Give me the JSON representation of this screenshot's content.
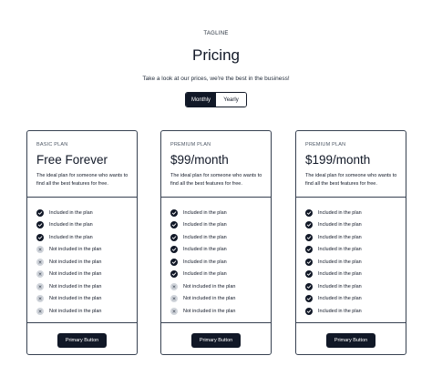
{
  "header": {
    "tagline": "TAGLINE",
    "title": "Pricing",
    "subtitle": "Take a look at our prices, we're the best in the business!"
  },
  "billing_toggle": {
    "options": [
      "Monthly",
      "Yearly"
    ],
    "selected": "Monthly"
  },
  "colors": {
    "primary": "#111827",
    "border": "#374151",
    "excluded_icon_bg": "#d1d5db"
  },
  "plans": [
    {
      "name": "BASIC PLAN",
      "price": "Free Forever",
      "description": "The ideal plan for someone who wants to find all the best features for free.",
      "features": [
        {
          "text": "Included in the plan",
          "included": true
        },
        {
          "text": "Included in the plan",
          "included": true
        },
        {
          "text": "Included in the plan",
          "included": true
        },
        {
          "text": "Not included in the plan",
          "included": false
        },
        {
          "text": "Not included in the plan",
          "included": false
        },
        {
          "text": "Not included in the plan",
          "included": false
        },
        {
          "text": "Not included in the plan",
          "included": false
        },
        {
          "text": "Not included in the plan",
          "included": false
        },
        {
          "text": "Not included in the plan",
          "included": false
        }
      ],
      "button_label": "Primary Button"
    },
    {
      "name": "PREMIUM PLAN",
      "price": "$99/month",
      "description": "The ideal plan for someone who wants to find all the best features for free.",
      "features": [
        {
          "text": "Included in the plan",
          "included": true
        },
        {
          "text": "Included in the plan",
          "included": true
        },
        {
          "text": "Included in the plan",
          "included": true
        },
        {
          "text": "Included in the plan",
          "included": true
        },
        {
          "text": "Included in the plan",
          "included": true
        },
        {
          "text": "Included in the plan",
          "included": true
        },
        {
          "text": "Not included in the plan",
          "included": false
        },
        {
          "text": "Not included in the plan",
          "included": false
        },
        {
          "text": "Not included in the plan",
          "included": false
        }
      ],
      "button_label": "Primary Button"
    },
    {
      "name": "PREMIUM PLAN",
      "price": "$199/month",
      "description": "The ideal plan for someone who wants to find all the best features for free.",
      "features": [
        {
          "text": "Included in the plan",
          "included": true
        },
        {
          "text": "Included in the plan",
          "included": true
        },
        {
          "text": "Included in the plan",
          "included": true
        },
        {
          "text": "Included in the plan",
          "included": true
        },
        {
          "text": "Included in the plan",
          "included": true
        },
        {
          "text": "Included in the plan",
          "included": true
        },
        {
          "text": "Included in the plan",
          "included": true
        },
        {
          "text": "Included in the plan",
          "included": true
        },
        {
          "text": "Included in the plan",
          "included": true
        }
      ],
      "button_label": "Primary Button"
    }
  ]
}
